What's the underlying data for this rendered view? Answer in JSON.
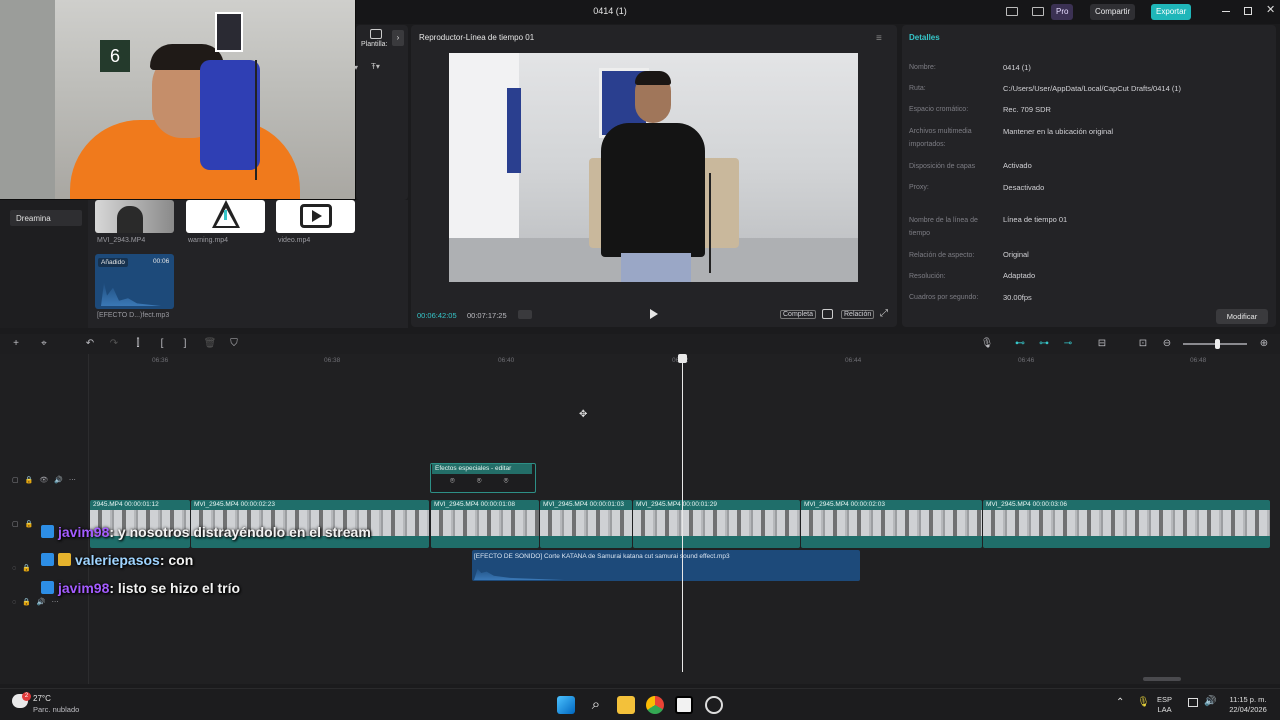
{
  "window": {
    "title": "0414 (1)"
  },
  "topbar": {
    "pro": "Pro",
    "share": "Compartir",
    "export": "Exportar"
  },
  "media": {
    "plantillas": "Plantilla:",
    "dreamina": "Dreamina",
    "thumbs": [
      {
        "label": "MVI_2943.MP4"
      },
      {
        "label": "warning.mp4"
      },
      {
        "label": "video.mp4"
      },
      {
        "label": "[EFECTO D...)fect.mp3",
        "badge": "Añadido",
        "duration": "00:06"
      }
    ]
  },
  "player": {
    "title": "Reproductor-Línea de tiempo 01",
    "current_time": "00:06:42:05",
    "total_time": "00:07:17:25",
    "btn_full": "Completa",
    "btn_ratio": "Relación"
  },
  "details": {
    "title": "Detalles",
    "rows": [
      {
        "k": "Nombre:",
        "v": "0414 (1)"
      },
      {
        "k": "Ruta:",
        "v": "C:/Users/User/AppData/Local/CapCut Drafts/0414 (1)"
      },
      {
        "k": "Espacio cromático:",
        "v": "Rec. 709 SDR"
      },
      {
        "k": "Archivos multimedia importados:",
        "v": "Mantener en la ubicación original"
      },
      {
        "k": "Disposición de capas",
        "v": "Activado"
      },
      {
        "k": "Proxy:",
        "v": "Desactivado"
      },
      {
        "k": "Nombre de la línea de tiempo",
        "v": "Línea de tiempo 01"
      },
      {
        "k": "Relación de aspecto:",
        "v": "Original"
      },
      {
        "k": "Resolución:",
        "v": "Adaptado"
      },
      {
        "k": "Cuadros por segundo:",
        "v": "30.00fps"
      }
    ],
    "modify": "Modificar"
  },
  "ruler": [
    "06:36",
    "06:38",
    "06:40",
    "06:42",
    "06:44",
    "06:46",
    "06:48"
  ],
  "clips": [
    {
      "label": "2945.MP4  00:00:01:12"
    },
    {
      "label": "MVI_2945.MP4  00:00:02:23"
    },
    {
      "label": "MVI_2945.MP4  00:00:01:08"
    },
    {
      "label": "MVI_2945.MP4  00:00:01:03"
    },
    {
      "label": "MVI_2945.MP4  00:00:01:29"
    },
    {
      "label": "MVI_2945.MP4  00:00:02:03"
    },
    {
      "label": "MVI_2945.MP4  00:00:03:06"
    }
  ],
  "fx_clip": {
    "label": "Efectos especiales - editar"
  },
  "audio_clip": {
    "label": "[EFECTO DE SONIDO] Corte KATANA de Samurai  katana cut samurai sound effect.mp3"
  },
  "chat": [
    {
      "user": "javim98",
      "msg": ": y nosotros distrayéndolo en el stream"
    },
    {
      "user": "valeriepasos",
      "msg": ": con"
    },
    {
      "user": "javim98",
      "msg": ": listo se hizo el trío"
    }
  ],
  "taskbar": {
    "temp": "27°C",
    "weather": "Parc. nublado",
    "weather_badge": "2",
    "lang1": "ESP",
    "lang2": "LAA",
    "time": "11:15 p. m.",
    "date": "22/04/2026"
  }
}
